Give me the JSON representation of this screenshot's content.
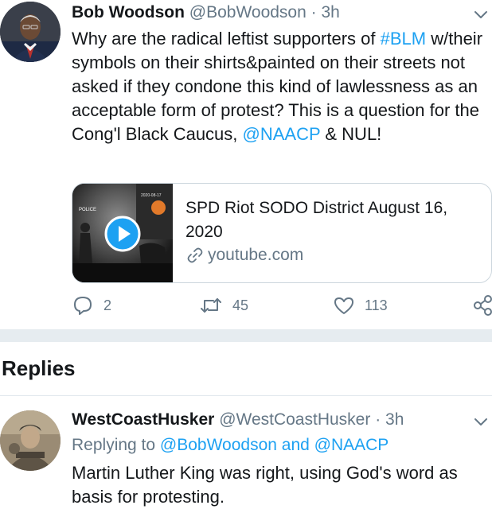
{
  "tweet": {
    "author_name": "Bob Woodson",
    "author_handle": "@BobWoodson",
    "separator": "·",
    "time": "3h",
    "text_part1": "Why are the radical leftist supporters of ",
    "hashtag": "#BLM",
    "text_part2": " w/their symbols on their shirts&painted on their streets not asked if they condone this kind of lawlessness as an acceptable form of  protest? This is a question for the Cong'l Black Caucus, ",
    "mention": "@NAACP",
    "text_part3": " & NUL!",
    "card": {
      "title": "SPD Riot SODO District August 16, 2020",
      "domain": "youtube.com",
      "thumb_overlay": "POLICE"
    },
    "actions": {
      "replies": "2",
      "retweets": "45",
      "likes": "113"
    }
  },
  "replies_heading": "Replies",
  "reply": {
    "author_name": "WestCoastHusker",
    "author_handle": "@WestCoastHusker",
    "separator": "·",
    "time": "3h",
    "replying_label": "Replying to ",
    "replying_mentions": "@BobWoodson and @NAACP",
    "text": "Martin Luther King was right, using God's word as basis for protesting."
  },
  "colors": {
    "link": "#1da1f2",
    "meta": "#657786",
    "divider": "#e6ecf0"
  },
  "icons": [
    "chevron-down-icon",
    "play-icon",
    "link-icon",
    "reply-icon",
    "retweet-icon",
    "like-icon",
    "share-icon"
  ]
}
